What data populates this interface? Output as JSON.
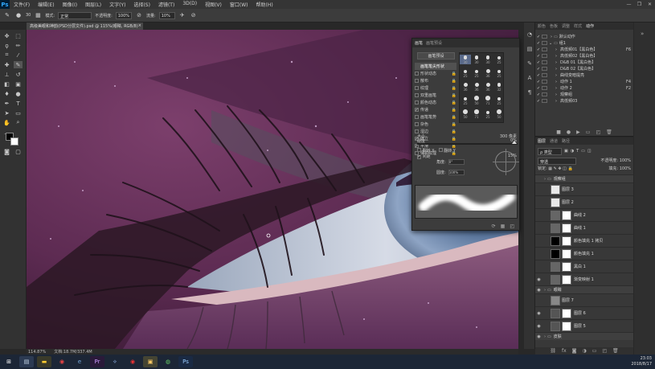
{
  "app": {
    "logo": "Ps"
  },
  "menu": [
    "文件(F)",
    "编辑(E)",
    "图像(I)",
    "图层(L)",
    "文字(Y)",
    "选择(S)",
    "滤镜(T)",
    "3D(D)",
    "视图(V)",
    "窗口(W)",
    "帮助(H)"
  ],
  "options": {
    "size": "30",
    "mode_label": "模式:",
    "mode_value": "正常",
    "opacity_label": "不透明度:",
    "opacity_value": "100%",
    "flow_label": "流量:",
    "flow_value": "10%"
  },
  "document": {
    "tab_title": "高级美眼和神韵(PSD分层文件).psd @ 115%(眼睛, RGB/8)",
    "close": "×"
  },
  "status": {
    "zoom": "114.87%",
    "doc": "文档:18.7M/337.4M"
  },
  "brush_panel": {
    "tabs": [
      "画笔",
      "画笔预设"
    ],
    "presets_button": "画笔预设",
    "items": [
      {
        "label": "画笔笔尖形状",
        "checked": false,
        "selected": true,
        "lock": false
      },
      {
        "label": "形状动态",
        "checked": false,
        "selected": false,
        "lock": true
      },
      {
        "label": "散布",
        "checked": false,
        "selected": false,
        "lock": true
      },
      {
        "label": "纹理",
        "checked": false,
        "selected": false,
        "lock": true
      },
      {
        "label": "双重画笔",
        "checked": false,
        "selected": false,
        "lock": true
      },
      {
        "label": "颜色动态",
        "checked": false,
        "selected": false,
        "lock": true
      },
      {
        "label": "传递",
        "checked": true,
        "selected": false,
        "lock": true
      },
      {
        "label": "画笔笔势",
        "checked": false,
        "selected": false,
        "lock": true
      },
      {
        "label": "杂色",
        "checked": false,
        "selected": false,
        "lock": true
      },
      {
        "label": "湿边",
        "checked": false,
        "selected": false,
        "lock": true
      },
      {
        "label": "建立",
        "checked": true,
        "selected": false,
        "lock": true
      },
      {
        "label": "平滑",
        "checked": true,
        "selected": false,
        "lock": true
      },
      {
        "label": "保护纹理",
        "checked": false,
        "selected": false,
        "lock": true
      }
    ],
    "tip_sizes": [
      "30",
      "30",
      "30",
      "25",
      "25",
      "25",
      "36",
      "25",
      "36",
      "36",
      "36",
      "32",
      "25",
      "50",
      "71",
      "25",
      "50",
      "71",
      "25",
      "50"
    ],
    "size_label": "大小",
    "size_value": "300 像素",
    "flip_x": "翻转 X",
    "flip_y": "翻转 Y",
    "angle_label": "角度:",
    "angle_value": "0°",
    "roundness_label": "圆度:",
    "roundness_value": "100%",
    "hardness_label": "硬度",
    "hardness_value": "0%",
    "spacing_label": "间距",
    "spacing_value": "15%"
  },
  "actions_panel": {
    "tabs": [
      "颜色",
      "色板",
      "调整",
      "样式",
      "动作"
    ],
    "items": [
      {
        "check": "✓",
        "indent": 0,
        "arrow": "›",
        "label": "默认动作",
        "shortcut": ""
      },
      {
        "check": "✓",
        "indent": 0,
        "arrow": "⌄",
        "label": "组1",
        "shortcut": ""
      },
      {
        "check": "✓",
        "indent": 1,
        "arrow": "›",
        "label": "高低频01【黑白色】",
        "shortcut": "F6"
      },
      {
        "check": "✓",
        "indent": 1,
        "arrow": "›",
        "label": "高低频02【黑白色】",
        "shortcut": ""
      },
      {
        "check": "✓",
        "indent": 1,
        "arrow": "›",
        "label": "D&B 01【黑白色】",
        "shortcut": ""
      },
      {
        "check": "✓",
        "indent": 1,
        "arrow": "›",
        "label": "D&B 02【黑白色】",
        "shortcut": ""
      },
      {
        "check": "✓",
        "indent": 1,
        "arrow": "›",
        "label": "曲线变暗提亮",
        "shortcut": ""
      },
      {
        "check": "✓",
        "indent": 1,
        "arrow": "›",
        "label": "动作 1",
        "shortcut": "F4"
      },
      {
        "check": "✓",
        "indent": 1,
        "arrow": "›",
        "label": "动作 2",
        "shortcut": "F2"
      },
      {
        "check": "✓",
        "indent": 1,
        "arrow": "›",
        "label": "观察组",
        "shortcut": ""
      },
      {
        "check": "✓",
        "indent": 1,
        "arrow": "›",
        "label": "高低频03",
        "shortcut": ""
      }
    ]
  },
  "layers_panel": {
    "tabs": [
      "图层",
      "通道",
      "路径"
    ],
    "filter_label": "ρ 类型",
    "blend_mode": "穿透",
    "opacity_label": "不透明度:",
    "opacity_value": "100%",
    "lock_label": "锁定:",
    "fill_label": "填充:",
    "fill_value": "100%",
    "layers": [
      {
        "name": "观察组",
        "type": "group",
        "eye": false,
        "thumb": "",
        "mask": false
      },
      {
        "name": "图层 3",
        "type": "layer",
        "eye": false,
        "thumb": "#e8e8e8",
        "mask": false
      },
      {
        "name": "图层 2",
        "type": "layer",
        "eye": false,
        "thumb": "#e8e8e8",
        "mask": false
      },
      {
        "name": "曲线 2",
        "type": "adj",
        "eye": false,
        "thumb": "#666666",
        "mask": true
      },
      {
        "name": "曲线 1",
        "type": "adj",
        "eye": false,
        "thumb": "#666666",
        "mask": true
      },
      {
        "name": "颜色填充 1 拷贝",
        "type": "adj",
        "eye": false,
        "thumb": "#000000",
        "mask": true
      },
      {
        "name": "颜色填充 1",
        "type": "adj",
        "eye": false,
        "thumb": "#000000",
        "mask": true
      },
      {
        "name": "黑白 1",
        "type": "adj",
        "eye": false,
        "thumb": "#666666",
        "mask": true
      },
      {
        "name": "渐变映射 1",
        "type": "adj",
        "eye": true,
        "thumb": "#666666",
        "mask": true
      },
      {
        "name": "眼睛",
        "type": "group",
        "eye": true,
        "thumb": "",
        "mask": false
      },
      {
        "name": "图层 7",
        "type": "layer",
        "eye": false,
        "thumb": "#888888",
        "mask": false
      },
      {
        "name": "图层 6",
        "type": "layer",
        "eye": true,
        "thumb": "#555555",
        "mask": true
      },
      {
        "name": "图层 5",
        "type": "layer",
        "eye": true,
        "thumb": "#555555",
        "mask": true
      },
      {
        "name": "皮肤",
        "type": "group",
        "eye": true,
        "thumb": "",
        "mask": false
      }
    ]
  },
  "taskbar": {
    "time": "23:03",
    "date": "2018/8/17"
  }
}
